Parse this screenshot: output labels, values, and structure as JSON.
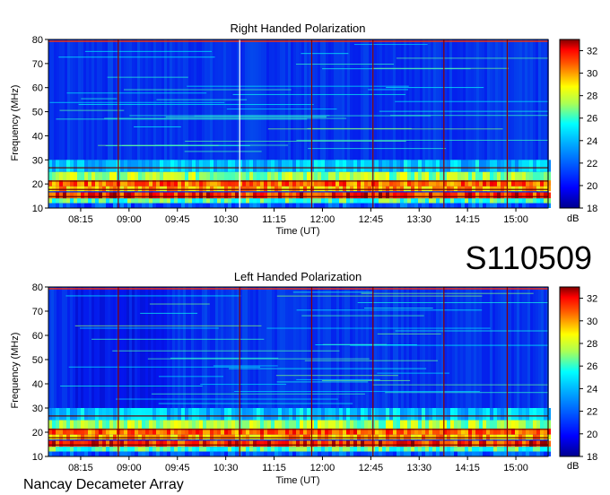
{
  "observation_id": "S110509",
  "instrument": "Nancay Decameter Array",
  "colors": {
    "colormap": [
      "#00008f",
      "#0000ff",
      "#00ffff",
      "#ffff00",
      "#ff0000",
      "#800000"
    ],
    "line_maroon": "#8b0000",
    "line_white": "#ffffff"
  },
  "chart_data": [
    {
      "type": "heatmap",
      "title": "Right Handed Polarization",
      "xlabel": "Time (UT)",
      "ylabel": "Frequency (MHz)",
      "x_range": [
        "07:45",
        "15:30"
      ],
      "x_ticks": [
        "08:15",
        "09:00",
        "09:45",
        "10:30",
        "11:15",
        "12:00",
        "12:45",
        "13:30",
        "14:15",
        "15:00"
      ],
      "y_range": [
        10,
        80
      ],
      "y_ticks": [
        10,
        20,
        30,
        40,
        50,
        60,
        70,
        80
      ],
      "colorbar": {
        "label": "dB",
        "range": [
          18,
          33
        ],
        "ticks": [
          18,
          20,
          22,
          24,
          26,
          28,
          30,
          32
        ]
      },
      "vertical_lines": [
        {
          "time": "08:50",
          "color": "maroon"
        },
        {
          "time": "10:43",
          "color": "white"
        },
        {
          "time": "11:50",
          "color": "maroon"
        },
        {
          "time": "12:47",
          "color": "maroon"
        },
        {
          "time": "13:53",
          "color": "maroon"
        },
        {
          "time": "14:52",
          "color": "maroon"
        }
      ]
    },
    {
      "type": "heatmap",
      "title": "Left Handed Polarization",
      "xlabel": "Time (UT)",
      "ylabel": "Frequency (MHz)",
      "x_range": [
        "07:45",
        "15:30"
      ],
      "x_ticks": [
        "08:15",
        "09:00",
        "09:45",
        "10:30",
        "11:15",
        "12:00",
        "12:45",
        "13:30",
        "14:15",
        "15:00"
      ],
      "y_range": [
        10,
        80
      ],
      "y_ticks": [
        10,
        20,
        30,
        40,
        50,
        60,
        70,
        80
      ],
      "colorbar": {
        "label": "dB",
        "range": [
          18,
          33
        ],
        "ticks": [
          18,
          20,
          22,
          24,
          26,
          28,
          30,
          32
        ]
      },
      "vertical_lines": [
        {
          "time": "08:50",
          "color": "maroon"
        },
        {
          "time": "10:43",
          "color": "maroon"
        },
        {
          "time": "11:50",
          "color": "maroon"
        },
        {
          "time": "12:47",
          "color": "maroon"
        },
        {
          "time": "13:53",
          "color": "maroon"
        },
        {
          "time": "14:52",
          "color": "maroon"
        }
      ]
    }
  ]
}
